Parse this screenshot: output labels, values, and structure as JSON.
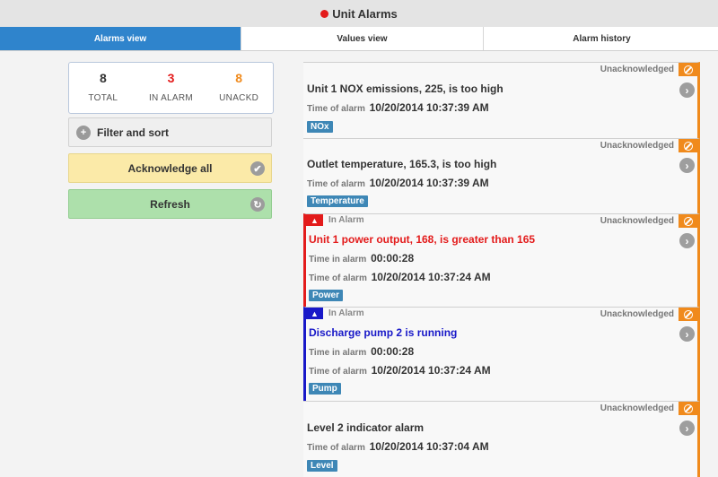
{
  "header": {
    "title": "Unit Alarms",
    "status_color": "#e31b1b"
  },
  "tabs": [
    {
      "label": "Alarms view",
      "active": true
    },
    {
      "label": "Values view",
      "active": false
    },
    {
      "label": "Alarm history",
      "active": false
    }
  ],
  "summary": {
    "total": {
      "value": "8",
      "label": "TOTAL",
      "color": "#333333"
    },
    "in_alarm": {
      "value": "3",
      "label": "IN ALARM",
      "color": "#e31b1b"
    },
    "unackd": {
      "value": "8",
      "label": "UNACKD",
      "color": "#f08a1c"
    }
  },
  "buttons": {
    "filter": "Filter and sort",
    "acknowledge": "Acknowledge all",
    "refresh": "Refresh"
  },
  "alarms": [
    {
      "ack_status": "Unacknowledged",
      "message": "Unit 1 NOX emissions, 225, is too high",
      "time_label": "Time of alarm",
      "time": "10/20/2014 10:37:39 AM",
      "tag": "NOx"
    },
    {
      "ack_status": "Unacknowledged",
      "message": "Outlet temperature, 165.3, is too high",
      "time_label": "Time of alarm",
      "time": "10/20/2014 10:37:39 AM",
      "tag": "Temperature"
    },
    {
      "state": "In Alarm",
      "severity_color": "#e31b1b",
      "ack_status": "Unacknowledged",
      "message": "Unit 1 power output, 168, is greater than 165",
      "duration_label": "Time in alarm",
      "duration": "00:00:28",
      "time_label": "Time of alarm",
      "time": "10/20/2014 10:37:24 AM",
      "tag": "Power"
    },
    {
      "state": "In Alarm",
      "severity_color": "#1818c8",
      "ack_status": "Unacknowledged",
      "message": "Discharge pump 2 is running",
      "duration_label": "Time in alarm",
      "duration": "00:00:28",
      "time_label": "Time of alarm",
      "time": "10/20/2014 10:37:24 AM",
      "tag": "Pump"
    },
    {
      "ack_status": "Unacknowledged",
      "message": "Level 2 indicator alarm",
      "time_label": "Time of alarm",
      "time": "10/20/2014 10:37:04 AM",
      "tag": "Level"
    }
  ]
}
